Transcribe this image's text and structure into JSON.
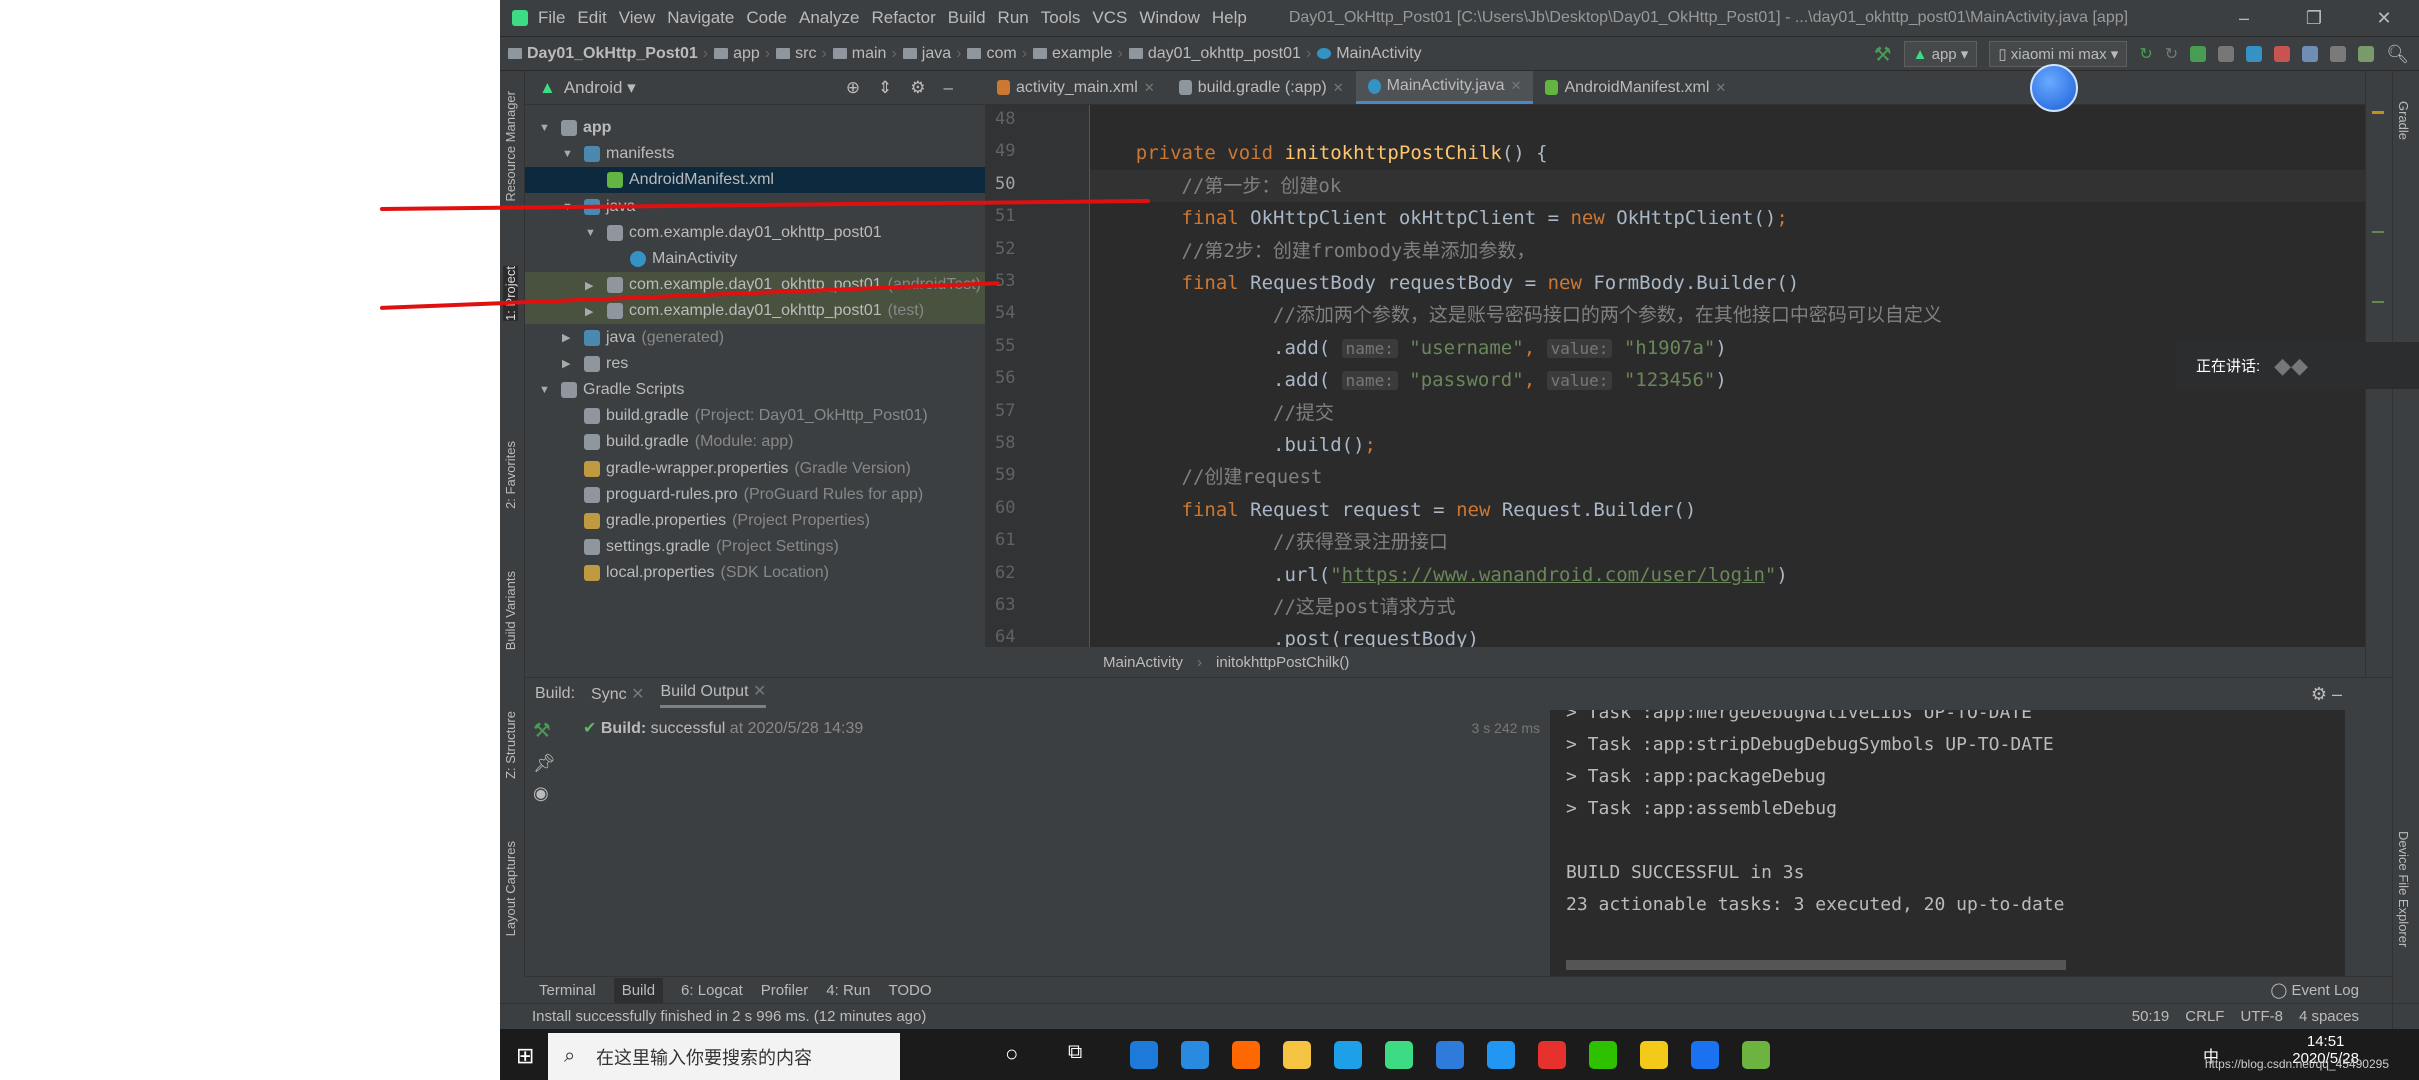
{
  "menu": [
    "File",
    "Edit",
    "View",
    "Navigate",
    "Code",
    "Analyze",
    "Refactor",
    "Build",
    "Run",
    "Tools",
    "VCS",
    "Window",
    "Help"
  ],
  "window_title": "Day01_OkHttp_Post01 [C:\\Users\\Jb\\Desktop\\Day01_OkHttp_Post01] - ...\\day01_okhttp_post01\\MainActivity.java [app]",
  "breadcrumb": [
    "Day01_OkHttp_Post01",
    "app",
    "src",
    "main",
    "java",
    "com",
    "example",
    "day01_okhttp_post01",
    "MainActivity"
  ],
  "run_config": "app",
  "device": "xiaomi mi max",
  "project_view": "Android",
  "left_tools": [
    "Resource Manager",
    "1: Project",
    "2: Favorites",
    "Build Variants",
    "Z: Structure",
    "Layout Captures"
  ],
  "right_tools": [
    "Gradle",
    "Device File Explorer"
  ],
  "tree": [
    {
      "label": "app",
      "hint": "",
      "indent": 0,
      "arrow": "▼",
      "icon": "module-folder-icon"
    },
    {
      "label": "manifests",
      "hint": "",
      "indent": 1,
      "arrow": "▼",
      "icon": "folder-icon"
    },
    {
      "label": "AndroidManifest.xml",
      "hint": "",
      "indent": 2,
      "arrow": "",
      "icon": "manifest-file-icon",
      "selected": true
    },
    {
      "label": "java",
      "hint": "",
      "indent": 1,
      "arrow": "▼",
      "icon": "folder-icon"
    },
    {
      "label": "com.example.day01_okhttp_post01",
      "hint": "",
      "indent": 2,
      "arrow": "▼",
      "icon": "package-icon"
    },
    {
      "label": "MainActivity",
      "hint": "",
      "indent": 3,
      "arrow": "",
      "icon": "class-icon"
    },
    {
      "label": "com.example.day01_okhttp_post01",
      "hint": "(androidTest)",
      "indent": 2,
      "arrow": "▶",
      "icon": "package-icon",
      "test": true
    },
    {
      "label": "com.example.day01_okhttp_post01",
      "hint": "(test)",
      "indent": 2,
      "arrow": "▶",
      "icon": "package-icon",
      "test": true
    },
    {
      "label": "java",
      "hint": "(generated)",
      "indent": 1,
      "arrow": "▶",
      "icon": "generated-folder-icon"
    },
    {
      "label": "res",
      "hint": "",
      "indent": 1,
      "arrow": "▶",
      "icon": "res-folder-icon"
    },
    {
      "label": "Gradle Scripts",
      "hint": "",
      "indent": 0,
      "arrow": "▼",
      "icon": "gradle-icon"
    },
    {
      "label": "build.gradle",
      "hint": "(Project: Day01_OkHttp_Post01)",
      "indent": 1,
      "arrow": "",
      "icon": "gradle-icon"
    },
    {
      "label": "build.gradle",
      "hint": "(Module: app)",
      "indent": 1,
      "arrow": "",
      "icon": "gradle-icon"
    },
    {
      "label": "gradle-wrapper.properties",
      "hint": "(Gradle Version)",
      "indent": 1,
      "arrow": "",
      "icon": "properties-icon"
    },
    {
      "label": "proguard-rules.pro",
      "hint": "(ProGuard Rules for app)",
      "indent": 1,
      "arrow": "",
      "icon": "file-icon"
    },
    {
      "label": "gradle.properties",
      "hint": "(Project Properties)",
      "indent": 1,
      "arrow": "",
      "icon": "properties-icon"
    },
    {
      "label": "settings.gradle",
      "hint": "(Project Settings)",
      "indent": 1,
      "arrow": "",
      "icon": "gradle-icon"
    },
    {
      "label": "local.properties",
      "hint": "(SDK Location)",
      "indent": 1,
      "arrow": "",
      "icon": "properties-icon"
    }
  ],
  "tabs": [
    {
      "label": "activity_main.xml",
      "active": false
    },
    {
      "label": "build.gradle (:app)",
      "active": false
    },
    {
      "label": "MainActivity.java",
      "active": true
    },
    {
      "label": "AndroidManifest.xml",
      "active": false
    }
  ],
  "code": [
    {
      "n": "48",
      "html": ""
    },
    {
      "n": "49",
      "html": "    <span class='kw'>private void </span><span class='fn'>initokhttpPostChilk</span>() {"
    },
    {
      "n": "50",
      "html": "        <span class='cm'>//第一步：创建ok</span>",
      "cur": true
    },
    {
      "n": "51",
      "html": "        <span class='kw'>final </span>OkHttpClient okHttpClient = <span class='kw'>new </span>OkHttpClient()<span class='kw'>;</span>"
    },
    {
      "n": "52",
      "html": "        <span class='cm'>//第2步：创建frombody表单添加参数，</span>"
    },
    {
      "n": "53",
      "html": "        <span class='kw'>final </span>RequestBody requestBody = <span class='kw'>new </span>FormBody.Builder()"
    },
    {
      "n": "54",
      "html": "                <span class='cm'>//添加两个参数，这是账号密码接口的两个参数，在其他接口中密码可以自定义</span>"
    },
    {
      "n": "55",
      "html": "                .add( <span class='hint2'>name:</span> <span class='st'>\"username\"</span><span class='kw'>,</span> <span class='hint2'>value:</span> <span class='st'>\"h1907a\"</span>)"
    },
    {
      "n": "56",
      "html": "                .add( <span class='hint2'>name:</span> <span class='st'>\"password\"</span><span class='kw'>,</span> <span class='hint2'>value:</span> <span class='st'>\"123456\"</span>)"
    },
    {
      "n": "57",
      "html": "                <span class='cm'>//提交</span>"
    },
    {
      "n": "58",
      "html": "                .build()<span class='kw'>;</span>"
    },
    {
      "n": "59",
      "html": "        <span class='cm'>//创建request</span>"
    },
    {
      "n": "60",
      "html": "        <span class='kw'>final </span>Request request = <span class='kw'>new </span>Request.Builder()"
    },
    {
      "n": "61",
      "html": "                <span class='cm'>//获得登录注册接口</span>"
    },
    {
      "n": "62",
      "html": "                .url(<span class='st'>\"</span><span class='url'>https://www.wanandroid.com/user/login</span><span class='st'>\"</span>)"
    },
    {
      "n": "63",
      "html": "                <span class='cm'>//这是post请求方式</span>"
    },
    {
      "n": "64",
      "html": "                .post(requestBody)"
    }
  ],
  "editor_breadcrumb": [
    "MainActivity",
    "initokhttpPostChilk()"
  ],
  "build": {
    "label": "Build:",
    "tabs": [
      "Sync",
      "Build Output"
    ],
    "result_bold": "Build:",
    "result_text": "successful",
    "result_time": "at 2020/5/28 14:39",
    "duration": "3 s 242 ms",
    "console": [
      "> Task :app:mergeDebugNativeLibs UP-TO-DATE",
      "> Task :app:stripDebugDebugSymbols UP-TO-DATE",
      "> Task :app:packageDebug",
      "> Task :app:assembleDebug",
      "",
      "BUILD SUCCESSFUL in 3s",
      "23 actionable tasks: 3 executed, 20 up-to-date"
    ]
  },
  "bottom_tabs": [
    "Terminal",
    "Build",
    "6: Logcat",
    "Profiler",
    "4: Run",
    "TODO"
  ],
  "event_log": "Event Log",
  "status": {
    "message": "Install successfully finished in 2 s 996 ms. (12 minutes ago)",
    "position": "50:19",
    "line_sep": "CRLF",
    "encoding": "UTF-8",
    "indent": "4 spaces"
  },
  "speaking": {
    "label": "正在讲话:"
  },
  "taskbar": {
    "search_placeholder": "在这里输入你要搜索的内容",
    "time": "14:51",
    "date": "2020/5/28",
    "watermark": "https://blog.csdn.net/qq_45490295",
    "ime": "中"
  }
}
